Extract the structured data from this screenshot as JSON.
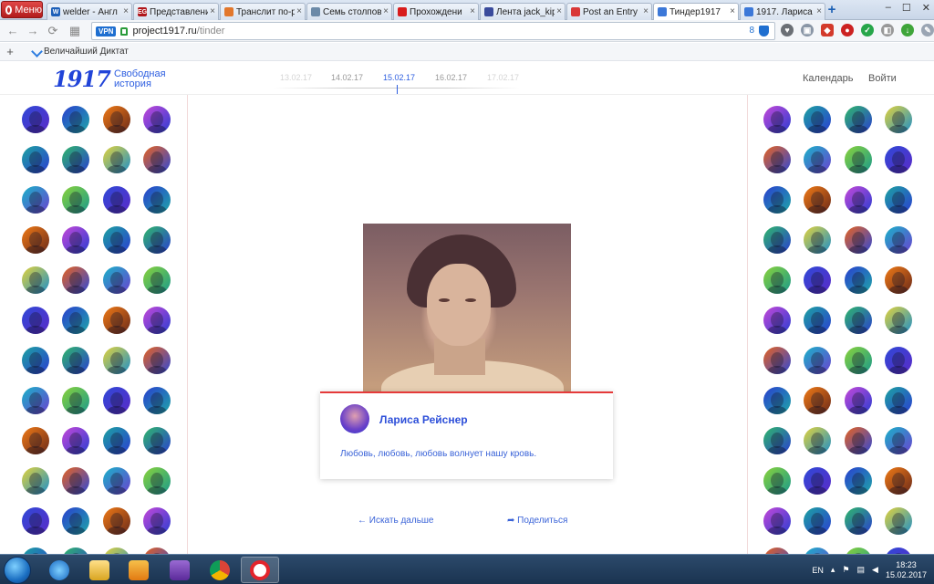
{
  "browser": {
    "menu_label": "Меню",
    "tabs": [
      {
        "label": "welder - Англ",
        "fav": "W",
        "color": "#1d5fb8",
        "active": false
      },
      {
        "label": "Представлени",
        "fav": "EG",
        "color": "#b0161b",
        "active": false
      },
      {
        "label": "Транслит по-р",
        "fav": "",
        "color": "#e2772c",
        "active": false
      },
      {
        "label": "Семь столпов",
        "fav": "",
        "color": "#6c8aa8",
        "active": false
      },
      {
        "label": "Прохождени",
        "fav": "",
        "color": "#d81c1c",
        "active": false
      },
      {
        "label": "Лента jack_kip",
        "fav": "",
        "color": "#3a4b9c",
        "active": false
      },
      {
        "label": "Post an Entry",
        "fav": "",
        "color": "#d93838",
        "active": false
      },
      {
        "label": "Тиндер1917",
        "fav": "",
        "color": "#3c78d8",
        "active": true
      },
      {
        "label": "1917. Лариса",
        "fav": "",
        "color": "#3c78d8",
        "active": false
      }
    ],
    "newtab_label": "+",
    "window_controls": [
      "‒",
      "☐",
      "✕"
    ],
    "vpn": "VPN",
    "url_host": "project1917.ru",
    "url_path": "/tinder",
    "url_counter": "8",
    "bookmark_add": "+",
    "bookmark_label": "Величайший Диктат"
  },
  "site": {
    "logo_number": "1917",
    "logo_line1": "Свободная",
    "logo_line2": "история",
    "dates": [
      "13.02.17",
      "14.02.17",
      "15.02.17",
      "16.02.17",
      "17.02.17"
    ],
    "active_date": "15.02.17",
    "nav_calendar": "Календарь",
    "nav_login": "Войти",
    "person_name": "Лариса Рейснер",
    "quote": "Любовь, любовь, любовь волнует нашу кровь.",
    "next_label": "← Искать дальше",
    "share_label": "Поделиться",
    "share_icon": "share-arrow-icon"
  },
  "taskbar": {
    "lang": "EN",
    "time": "18:23",
    "date": "15.02.2017"
  },
  "colors": {
    "accent": "#2d5ee0",
    "card_border": "#e53a3a"
  }
}
